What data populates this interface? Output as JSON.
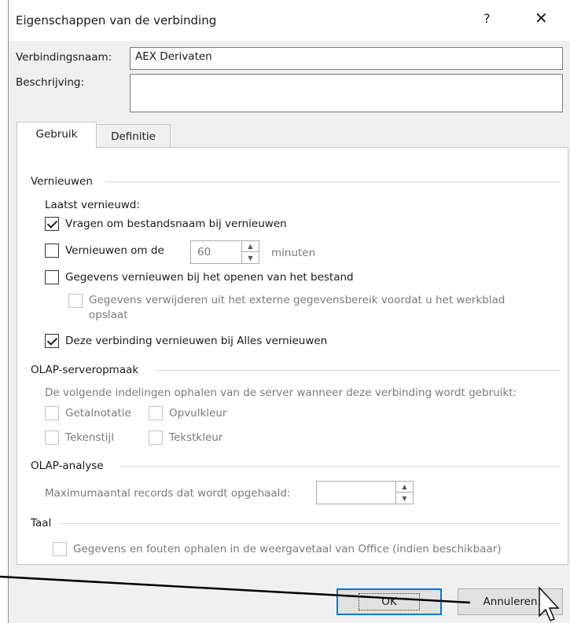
{
  "window": {
    "title": "Eigenschappen van de verbinding",
    "help": "?",
    "close": "✕"
  },
  "connection": {
    "name_label": "Verbindingsnaam:",
    "name_value": "AEX Derivaten",
    "desc_label": "Beschrijving:",
    "desc_value": ""
  },
  "tabs": [
    {
      "label": "Gebruik"
    },
    {
      "label": "Definitie"
    }
  ],
  "refresh": {
    "group_label": "Vernieuwen",
    "last_label": "Laatst vernieuwd:",
    "ask_filename": "Vragen om bestandsnaam bij vernieuwen",
    "every_label": "Vernieuwen om de",
    "every_value": "60",
    "every_unit": "minuten",
    "on_open": "Gegevens vernieuwen bij het openen van het bestand",
    "remove_data": "Gegevens verwijderen uit het externe gegevensbereik voordat u het werkblad opslaat",
    "refresh_all": "Deze verbinding vernieuwen bij Alles vernieuwen"
  },
  "olap_format": {
    "group_label": "OLAP-serveropmaak",
    "desc": "De volgende indelingen ophalen van de server wanneer deze verbinding wordt gebruikt:",
    "number_format": "Getalnotatie",
    "fill_color": "Opvulkleur",
    "font_style": "Tekenstijl",
    "text_color": "Tekstkleur"
  },
  "olap_analysis": {
    "group_label": "OLAP-analyse",
    "max_label": "Maximumaantal records dat wordt opgehaald:",
    "max_value": ""
  },
  "language": {
    "group_label": "Taal",
    "option": "Gegevens en fouten ophalen in de weergavetaal van Office (indien beschikbaar)"
  },
  "buttons": {
    "ok": "OK",
    "cancel": "Annuleren"
  },
  "colors": {
    "accent": "#0078d7",
    "dialog_bg": "#f0f0f0"
  }
}
